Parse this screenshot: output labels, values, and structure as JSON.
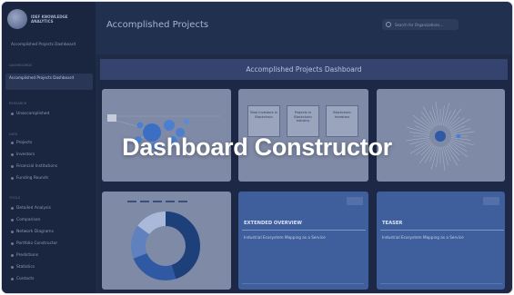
{
  "sidebar": {
    "brand": "IDEF KNOWLEDGE ANALYTICS",
    "subtitle": "Accomplished Projects Dashboard",
    "section1": "Dashboards",
    "active_item": "Accomplished Projects Dashboard",
    "section2": "Research",
    "item_unaccomplished": "Unaccomplished",
    "section3": "Data",
    "items_data": [
      "Projects",
      "Investors",
      "Financial Institutions",
      "Funding Rounds"
    ],
    "section4": "Tools",
    "items_tools": [
      "Detailed Analysis",
      "Comparison",
      "Network Diagrams",
      "Portfolio Constructor",
      "Predictions",
      "Statistics",
      "Contacts"
    ]
  },
  "topbar": {
    "title": "Accomplished Projects",
    "search_placeholder": "Search for Organizations..."
  },
  "main": {
    "banner": "Accomplished Projects Dashboard",
    "card2_boxes": [
      "Total Investors in Blockchain",
      "Projects in Blockchain Industry",
      "Blockchain Investors"
    ],
    "card5_title": "EXTENDED OVERVIEW",
    "card5_sub": "Industrial Ecosystem Mapping as a Service",
    "card6_title": "TEASER",
    "card6_sub": "Industrial Ecosystem Mapping as a Service"
  },
  "overlay_text": "Dashboard Constructor",
  "colors": {
    "frame": "#1f2a44",
    "sidebar": "#1a2540",
    "banner": "#34446e",
    "card_light": "#7f8aa6",
    "card_blue": "#3f5e9c",
    "donut_dark": "#1d3f7a",
    "donut_mid": "#5f82bf",
    "donut_light": "#aab9d9"
  }
}
